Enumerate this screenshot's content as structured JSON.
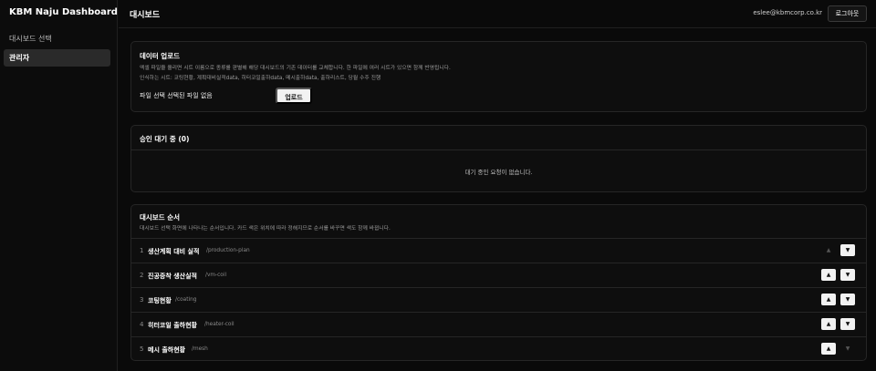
{
  "sidebar": {
    "brand": "KBM Naju Dashboard",
    "items": [
      {
        "label": "대시보드 선택",
        "active": false
      },
      {
        "label": "관리자",
        "active": true
      }
    ]
  },
  "header": {
    "title": "대시보드",
    "email": "eslee@kbmcorp.co.kr",
    "logout_label": "로그아웃"
  },
  "upload": {
    "title": "데이터 업로드",
    "description": "엑셀 파일을 올리면 시트 이름으로 종류를 판별해 해당 대시보드의 기존 데이터를 교체합니다. 한 파일에 여러 시트가 있으면 함께 반영됩니다.",
    "recognized_sheets": "인식하는 시트: 코팅현황, 계획대비실적data, 히터코일출하data, 메시출하data, 출하리스트, 당월 수주 진행",
    "file_label": "파일 선택  선택된 파일 없음",
    "upload_label": "업로드"
  },
  "pending": {
    "title": "승인 대기 중 (0)",
    "empty_message": "대기 중인 요청이 없습니다."
  },
  "order": {
    "title": "대시보드 순서",
    "description": "대시보드 선택 화면에 나타나는 순서입니다. 카드 색은 위치에 따라 정해지므로 순서를 바꾸면 색도 함께 바뀝니다.",
    "rows": [
      {
        "num": "1",
        "name": "생산계획 대비 실적",
        "path": "/production-plan",
        "up_enabled": false,
        "down_enabled": true
      },
      {
        "num": "2",
        "name": "진공증착 생산실적",
        "path": "/vm-coil",
        "up_enabled": true,
        "down_enabled": true
      },
      {
        "num": "3",
        "name": "코팅현황",
        "path": "/coating",
        "up_enabled": true,
        "down_enabled": true
      },
      {
        "num": "4",
        "name": "히터코일 출하현황",
        "path": "/heater-coil",
        "up_enabled": true,
        "down_enabled": true
      },
      {
        "num": "5",
        "name": "메시 출하현황",
        "path": "/mesh",
        "up_enabled": true,
        "down_enabled": false
      }
    ],
    "up_symbol": "▲",
    "down_symbol": "▼"
  }
}
